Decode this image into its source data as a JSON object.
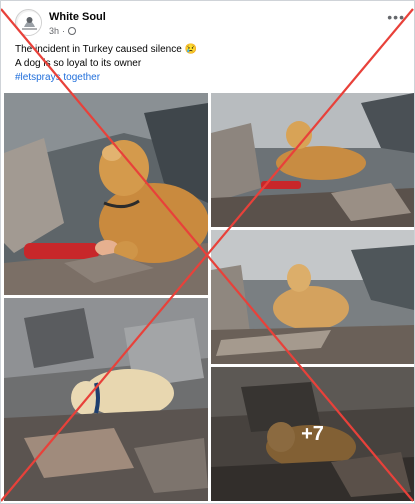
{
  "post": {
    "author": "White Soul",
    "time": "3h",
    "line1": "The incident in Turkey caused silence 😢",
    "line2": "A dog is so loyal to its owner",
    "hashtag": "#letsprays together",
    "more_count": "+7"
  },
  "icons": [
    "avatar-logo",
    "globe-icon",
    "more-options-icon"
  ],
  "colors": {
    "hashtag": "#216fdb",
    "cross": "#e8413a",
    "text": "#050505",
    "secondary": "#65676b"
  },
  "overlay": "red cross marking the post as false"
}
